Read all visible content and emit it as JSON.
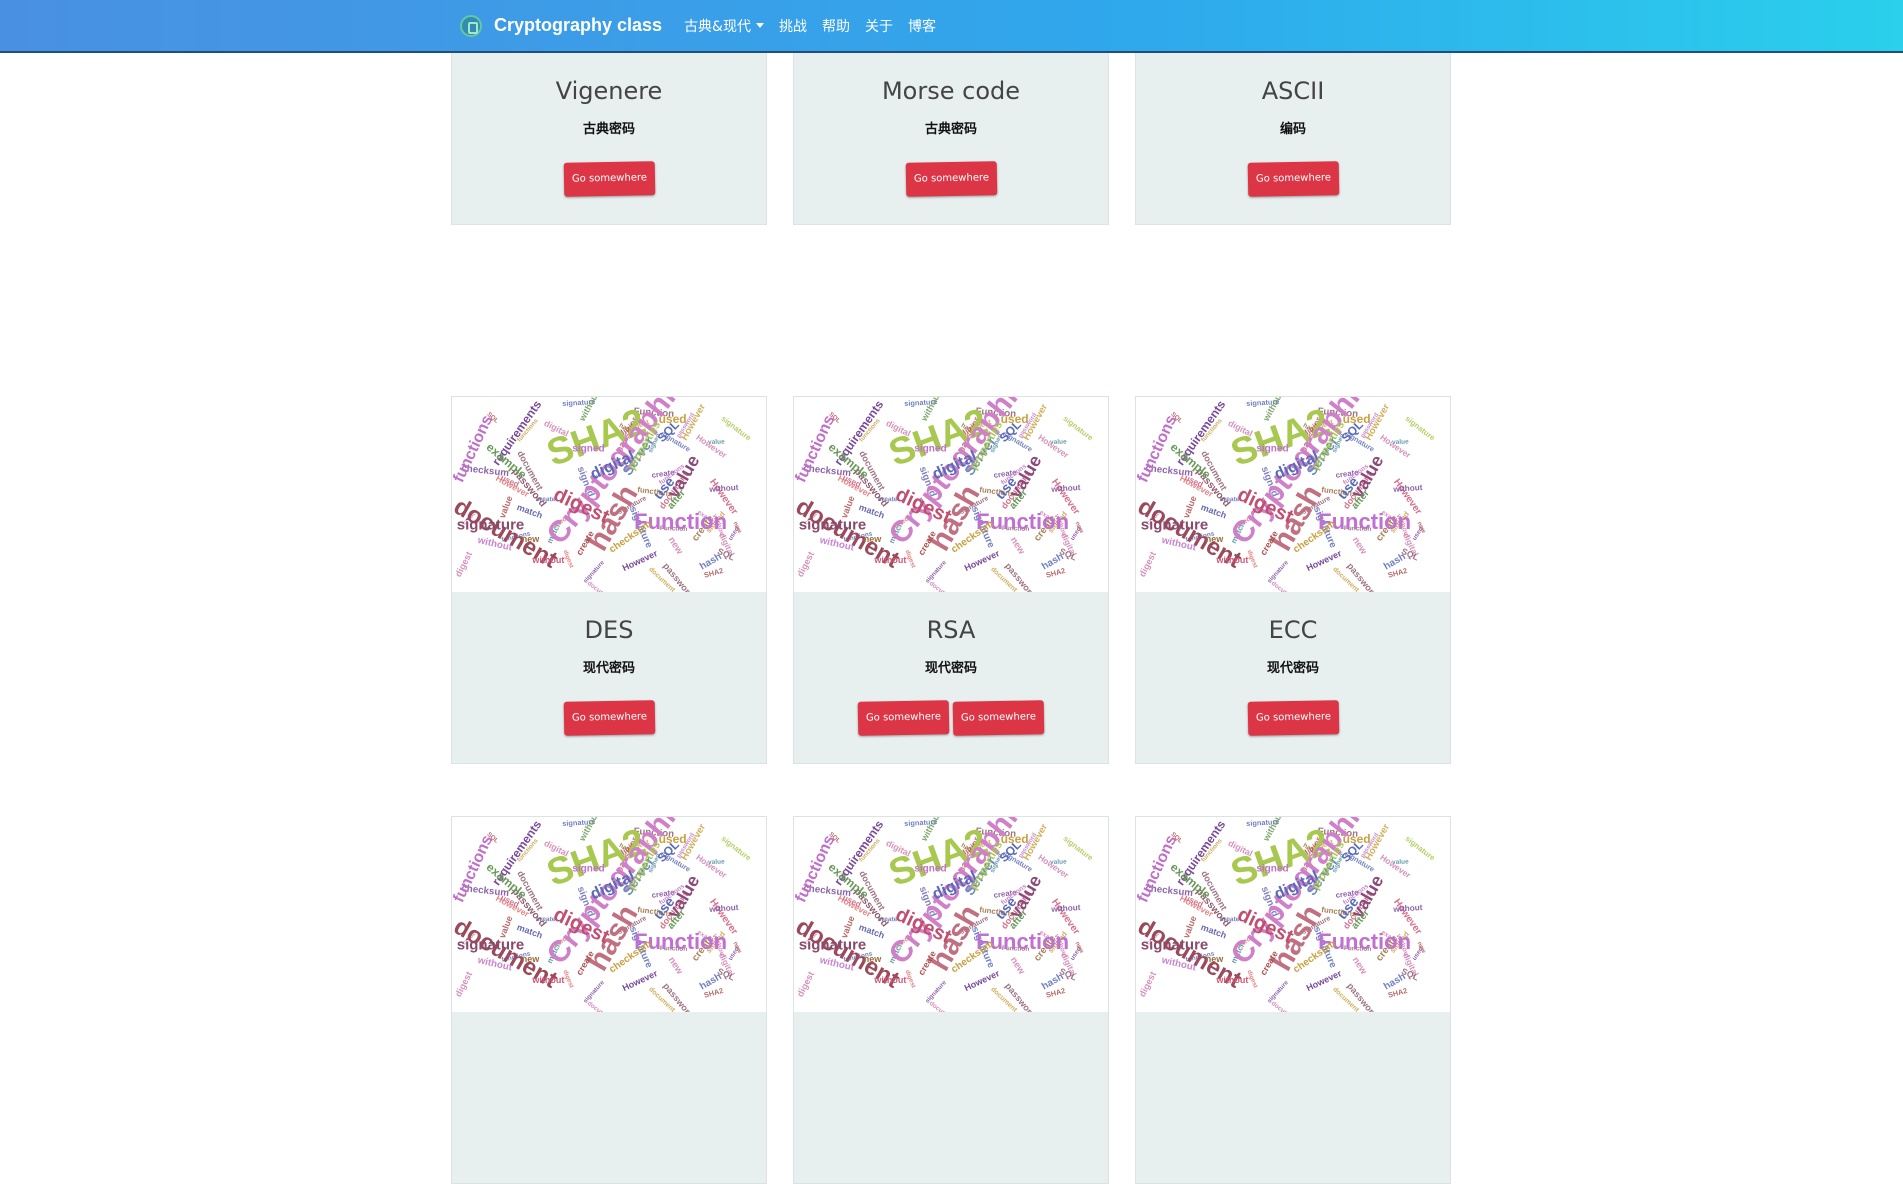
{
  "navbar": {
    "brand": "Cryptography class",
    "dropdown_label": "古典&现代",
    "items": [
      "挑战",
      "帮助",
      "关于",
      "博客"
    ]
  },
  "cards": [
    {
      "title": "Vigenere",
      "subtitle": "古典密码",
      "buttons": [
        "Go somewhere"
      ]
    },
    {
      "title": "Morse code",
      "subtitle": "古典密码",
      "buttons": [
        "Go somewhere"
      ]
    },
    {
      "title": "ASCII",
      "subtitle": "编码",
      "buttons": [
        "Go somewhere"
      ]
    },
    {
      "title": "DES",
      "subtitle": "现代密码",
      "buttons": [
        "Go somewhere"
      ]
    },
    {
      "title": "RSA",
      "subtitle": "现代密码",
      "buttons": [
        "Go somewhere",
        "Go somewhere"
      ]
    },
    {
      "title": "ECC",
      "subtitle": "现代密码",
      "buttons": [
        "Go somewhere"
      ]
    },
    {
      "title": "",
      "subtitle": "",
      "buttons": []
    },
    {
      "title": "",
      "subtitle": "",
      "buttons": []
    },
    {
      "title": "",
      "subtitle": "",
      "buttons": []
    }
  ],
  "wordcloud_words": [
    "SHA2",
    "Cryptographic",
    "hash",
    "document",
    "digest",
    "Function",
    "signature",
    "digital",
    "value",
    "Server",
    "functions",
    "requirements",
    "password",
    "example",
    "checksum",
    "signed",
    "properties",
    "create",
    "without",
    "However",
    "match",
    "use",
    "new",
    "after",
    "SQL",
    "used"
  ],
  "colors": {
    "accent": "#dc3545",
    "card_body": "#e8efef"
  }
}
